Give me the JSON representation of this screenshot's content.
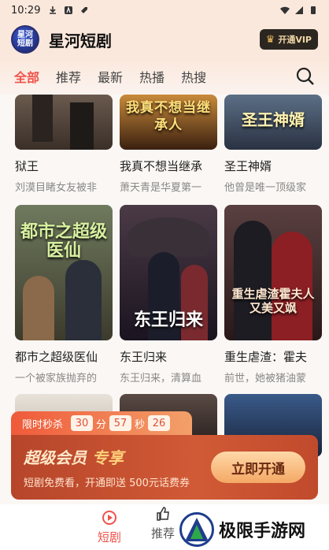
{
  "status_bar": {
    "time": "10:29"
  },
  "header": {
    "app_name": "星河短剧",
    "logo_text_1": "星河",
    "logo_text_2": "短剧",
    "vip_label": "开通VIP"
  },
  "tabs": [
    {
      "label": "全部",
      "active": true
    },
    {
      "label": "推荐",
      "active": false
    },
    {
      "label": "最新",
      "active": false
    },
    {
      "label": "热播",
      "active": false
    },
    {
      "label": "热搜",
      "active": false
    }
  ],
  "rows": [
    [
      {
        "title": "狱王",
        "desc": "刘漠目睹女友被非",
        "poster_text": ""
      },
      {
        "title": "我真不想当继承",
        "desc": "萧天青是华夏第一",
        "poster_text": "我真不想当继承人"
      },
      {
        "title": "圣王神婿",
        "desc": "他曾是唯一顶级家",
        "poster_text": "圣王神婿"
      }
    ],
    [
      {
        "title": "都市之超级医仙",
        "desc": "一个被家族抛弃的",
        "poster_text": "都市之超级医仙"
      },
      {
        "title": "东王归来",
        "desc": "东王归来，清算血",
        "poster_text": "东王归来"
      },
      {
        "title": "重生虐渣：霍夫",
        "desc": "前世，她被猪油蒙",
        "poster_text": "重生虐渣霍夫人又美又飒"
      }
    ]
  ],
  "promo": {
    "timer_label": "限时秒杀",
    "minutes": "30",
    "minutes_unit": "分",
    "seconds": "57",
    "seconds_unit": "秒",
    "millis": "26",
    "title_a": "超级会员",
    "title_b": "专享",
    "subtitle": "短剧免费看，开通即送 500元话费券",
    "button": "立即开通"
  },
  "bottom_nav": [
    {
      "label": "短剧",
      "active": true
    },
    {
      "label": "推荐",
      "active": false
    }
  ],
  "watermark": {
    "text": "极限手游网"
  }
}
